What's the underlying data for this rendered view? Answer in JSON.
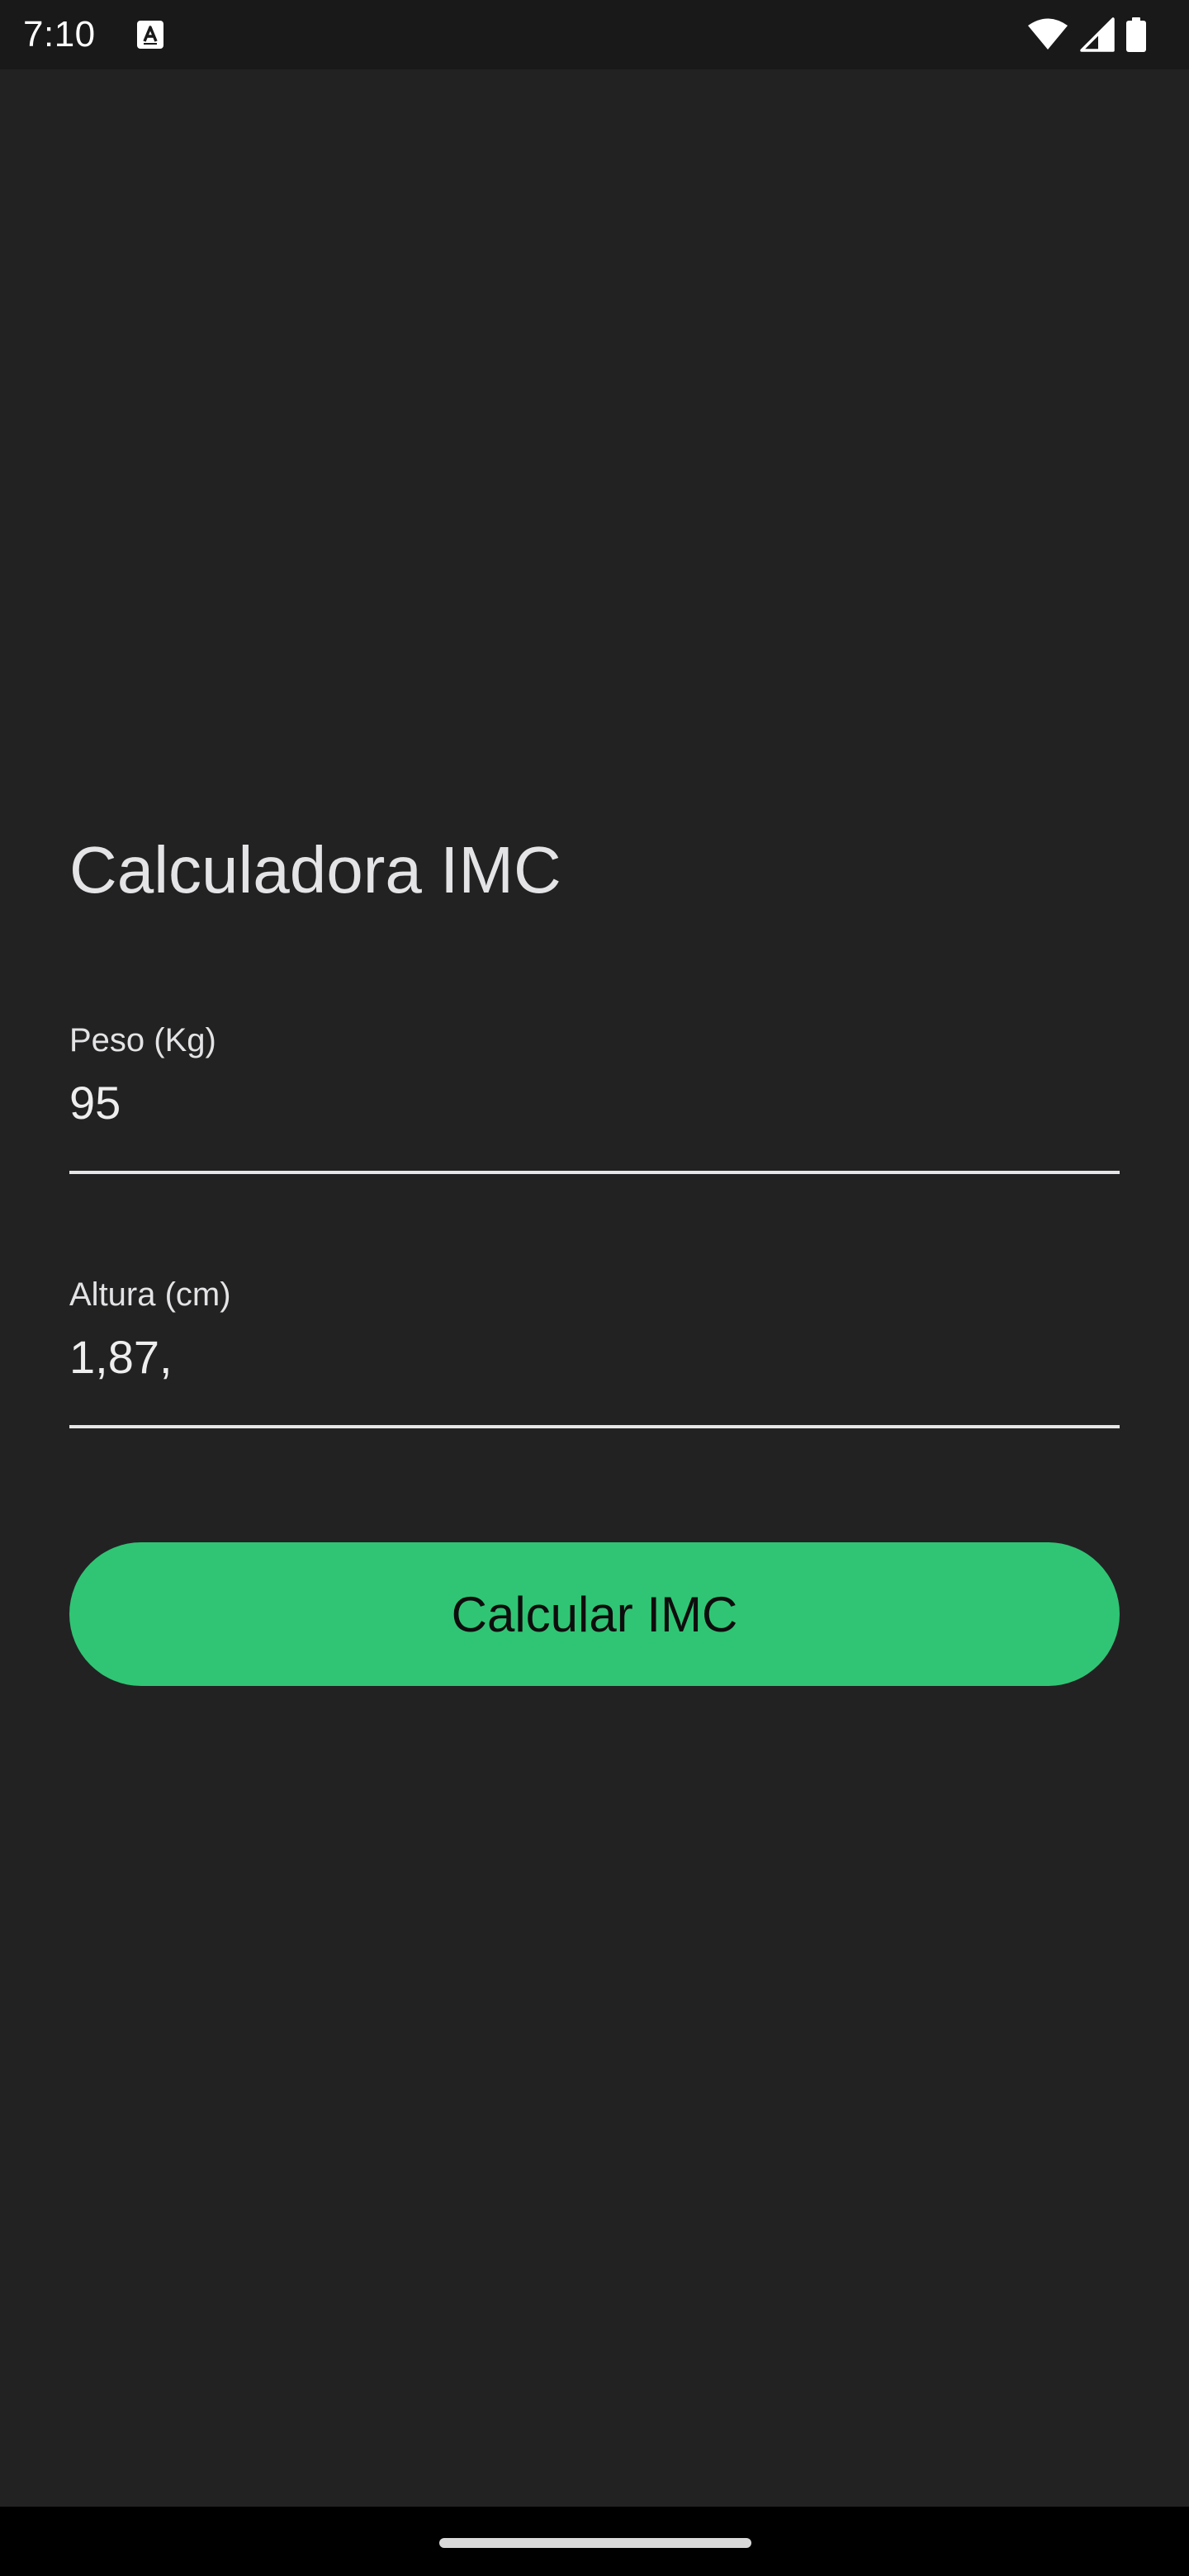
{
  "status_bar": {
    "time": "7:10",
    "icons": [
      "notification-a-icon",
      "wifi-icon",
      "cell-signal-icon",
      "battery-icon"
    ]
  },
  "screen": {
    "title": "Calculadora IMC",
    "weight_field": {
      "label": "Peso (Kg)",
      "value": "95"
    },
    "height_field": {
      "label": "Altura (cm)",
      "value": "1,87,"
    },
    "calculate_button": {
      "label": "Calcular IMC"
    }
  },
  "colors": {
    "background": "#222223",
    "status_bar": "#19191a",
    "accent": "#30c574",
    "text": "#e4e4e6",
    "nav_bar": "#000000"
  }
}
